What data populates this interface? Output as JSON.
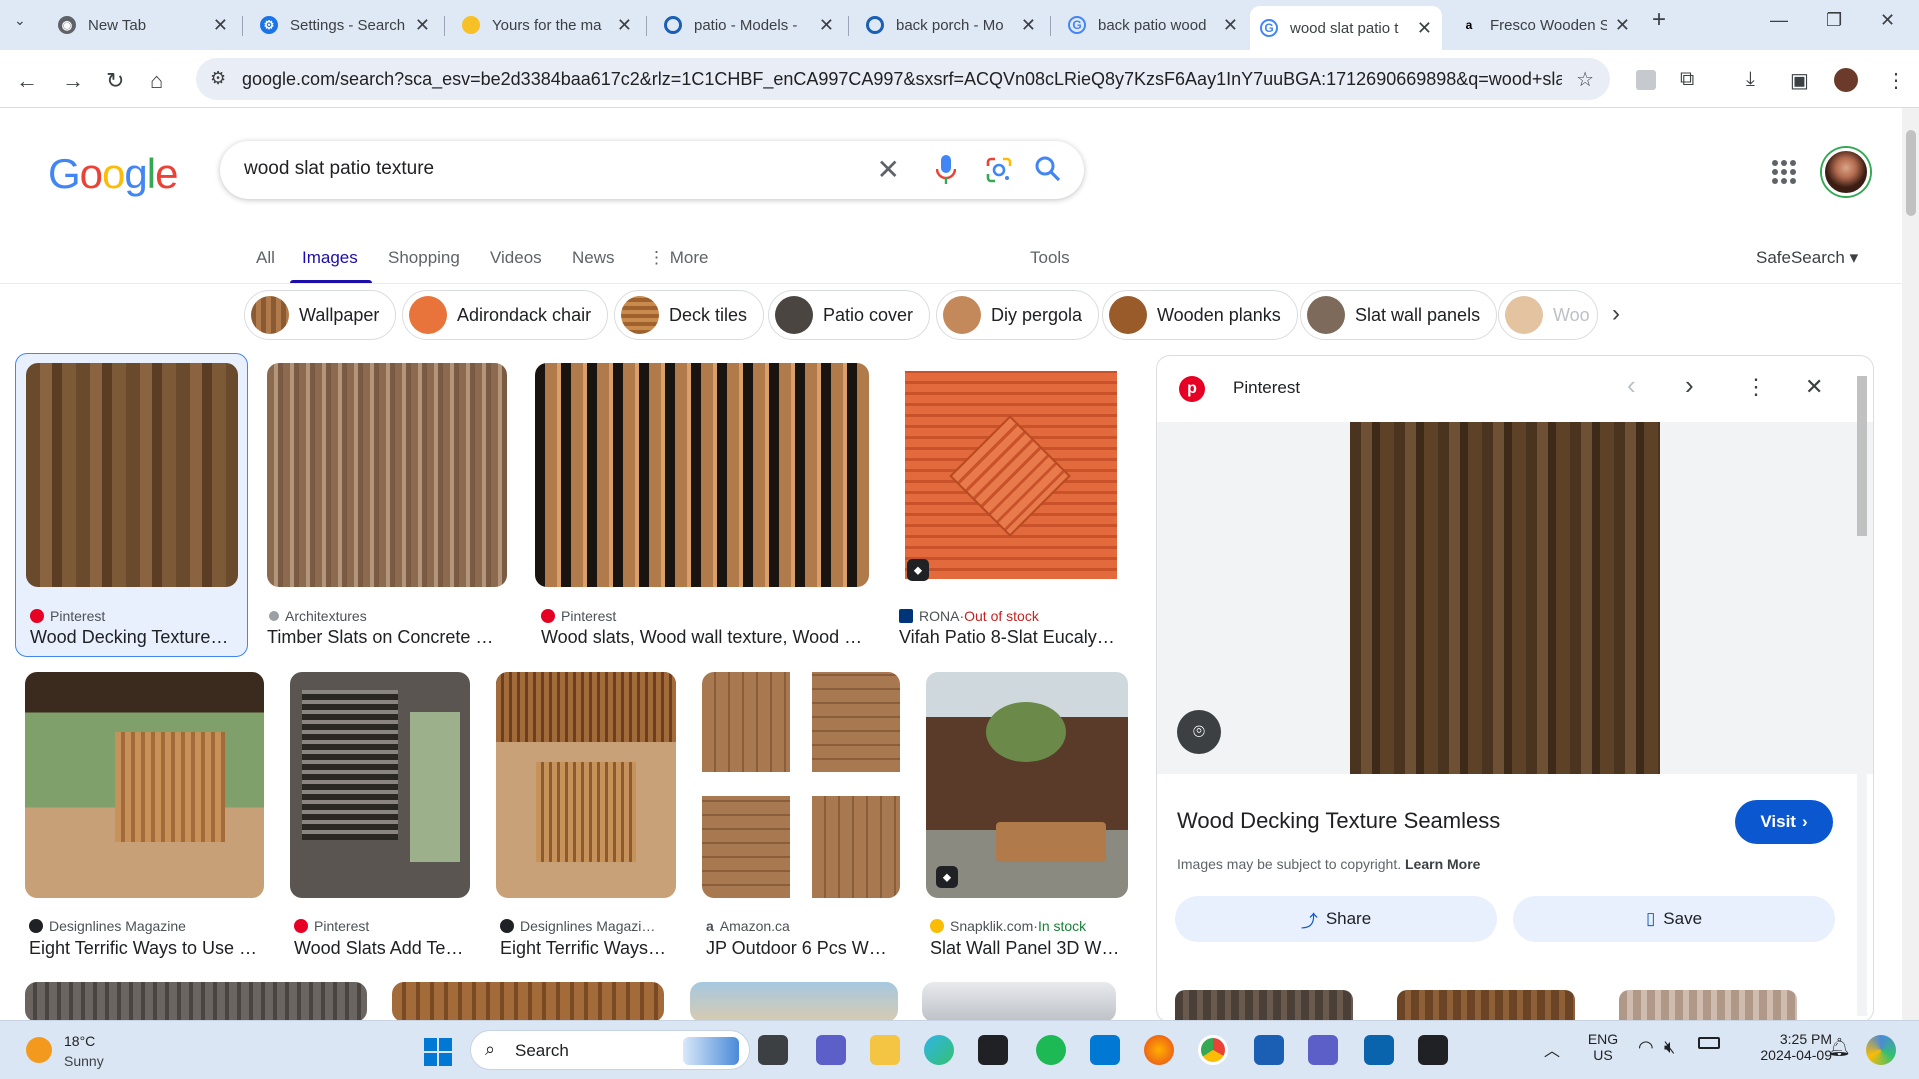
{
  "browser": {
    "tabs": [
      {
        "title": "New Tab",
        "icon": "chrome-icon"
      },
      {
        "title": "Settings - Search",
        "icon": "gear-icon"
      },
      {
        "title": "Yours for the ma",
        "icon": "emoji-icon"
      },
      {
        "title": "patio - Models -",
        "icon": "sketchup-icon"
      },
      {
        "title": "back porch - Mo",
        "icon": "sketchup-icon"
      },
      {
        "title": "back patio wood",
        "icon": "google-icon"
      },
      {
        "title": "wood slat patio t",
        "icon": "google-icon"
      },
      {
        "title": "Fresco Wooden S",
        "icon": "amazon-icon"
      }
    ],
    "active_tab": 6,
    "url": "google.com/search?sca_esv=be2d3384baa617c2&rlz=1C1CHBF_enCA997CA997&sxsrf=ACQVn08cLRieQ8y7KzsF6Aay1InY7uuBGA:1712690669898&q=wood+slat+patio+..."
  },
  "google": {
    "logo": "Google",
    "query": "wood slat patio texture",
    "tabs": [
      "All",
      "Images",
      "Shopping",
      "Videos",
      "News",
      "More"
    ],
    "active_tab": "Images",
    "tools_label": "Tools",
    "safesearch_label": "SafeSearch",
    "chips": [
      "Wallpaper",
      "Adirondack chair",
      "Deck tiles",
      "Patio cover",
      "Diy pergola",
      "Wooden planks",
      "Slat wall panels",
      "Woo"
    ]
  },
  "results_row1": [
    {
      "source": "Pinterest",
      "caption": "Wood Decking Texture…",
      "status": ""
    },
    {
      "source": "Architextures",
      "caption": "Timber Slats on Concrete …",
      "status": ""
    },
    {
      "source": "Pinterest",
      "caption": "Wood slats, Wood wall texture, Wood …",
      "status": ""
    },
    {
      "source": "RONA",
      "caption": "Vifah Patio 8-Slat Eucaly…",
      "status": "Out of stock"
    }
  ],
  "results_row2": [
    {
      "source": "Designlines Magazine",
      "caption": "Eight Terrific Ways to Use …",
      "status": ""
    },
    {
      "source": "Pinterest",
      "caption": "Wood Slats Add Te…",
      "status": ""
    },
    {
      "source": "Designlines Magazi…",
      "caption": "Eight Terrific Ways…",
      "status": ""
    },
    {
      "source": "Amazon.ca",
      "caption": "JP Outdoor 6 Pcs W…",
      "status": ""
    },
    {
      "source": "Snapklik.com",
      "caption": "Slat Wall Panel 3D W…",
      "status": "In stock"
    }
  ],
  "preview": {
    "source": "Pinterest",
    "title": "Wood Decking Texture Seamless",
    "copyright": "Images may be subject to copyright.",
    "learn_more": "Learn More",
    "visit_label": "Visit",
    "share_label": "Share",
    "save_label": "Save"
  },
  "taskbar": {
    "temp": "18°C",
    "weather": "Sunny",
    "search_label": "Search",
    "lang": "ENG",
    "region": "US",
    "time": "3:25 PM",
    "date": "2024-04-09"
  },
  "colors": {
    "link_blue": "#1a0dab",
    "visit_blue": "#0b57d0",
    "out_of_stock": "#c5221f",
    "in_stock": "#188038"
  }
}
